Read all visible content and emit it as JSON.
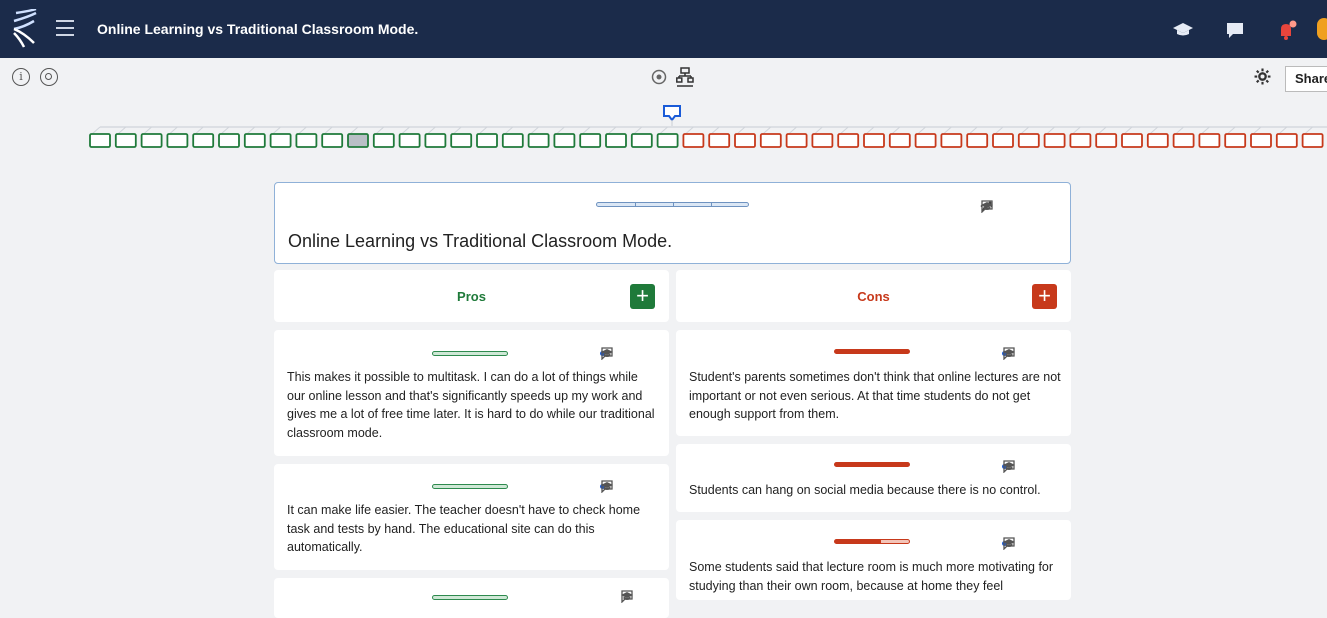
{
  "app": {
    "title": "Online Learning vs Traditional Classroom Mode."
  },
  "toolbar": {
    "share_label": "Share",
    "info_glyph": "i"
  },
  "icons": {
    "logo": "kialo-logo-icon",
    "menu": "hamburger-menu-icon",
    "education": "graduation-cap-icon",
    "chat": "chat-icon",
    "notifications": "bell-icon",
    "info": "info-icon",
    "view": "eye-icon",
    "sunburst": "sunburst-view-icon",
    "tree": "tree-view-icon",
    "settings": "gear-icon",
    "more": "ellipsis-icon",
    "edit": "pencil-icon",
    "comment": "comment-icon"
  },
  "colors": {
    "topbar": "#1b2b4a",
    "pro": "#1f7a3a",
    "con": "#c7391b",
    "accent": "#1a5bd8",
    "notification": "#e8453c"
  },
  "tree": {
    "pro_count": 23,
    "con_count": 26,
    "highlighted_pro_index": 10
  },
  "thesis": {
    "title": "Online Learning vs Traditional Classroom Mode."
  },
  "columns": {
    "pros": {
      "label": "Pros",
      "add_symbol": "+"
    },
    "cons": {
      "label": "Cons",
      "add_symbol": "+"
    }
  },
  "pros": [
    {
      "text": "This makes it possible to multitask. I can do a lot of things while our online lesson and that's significantly speeds up my work and gives me a lot of free time later. It is hard to do while our traditional classroom mode."
    },
    {
      "text": "It can make life easier. The teacher doesn't have to check home task and tests by hand. The educational site can do this automatically."
    },
    {
      "text": ""
    }
  ],
  "cons": [
    {
      "text": "Student's parents sometimes don't think that online lectures are not important or not even serious. At that time students do not get enough support from them."
    },
    {
      "text": "Students can hang on social media because there is no control."
    },
    {
      "text": "Some students said that lecture room is much more motivating for studying than their own room, because at home they feel"
    }
  ]
}
